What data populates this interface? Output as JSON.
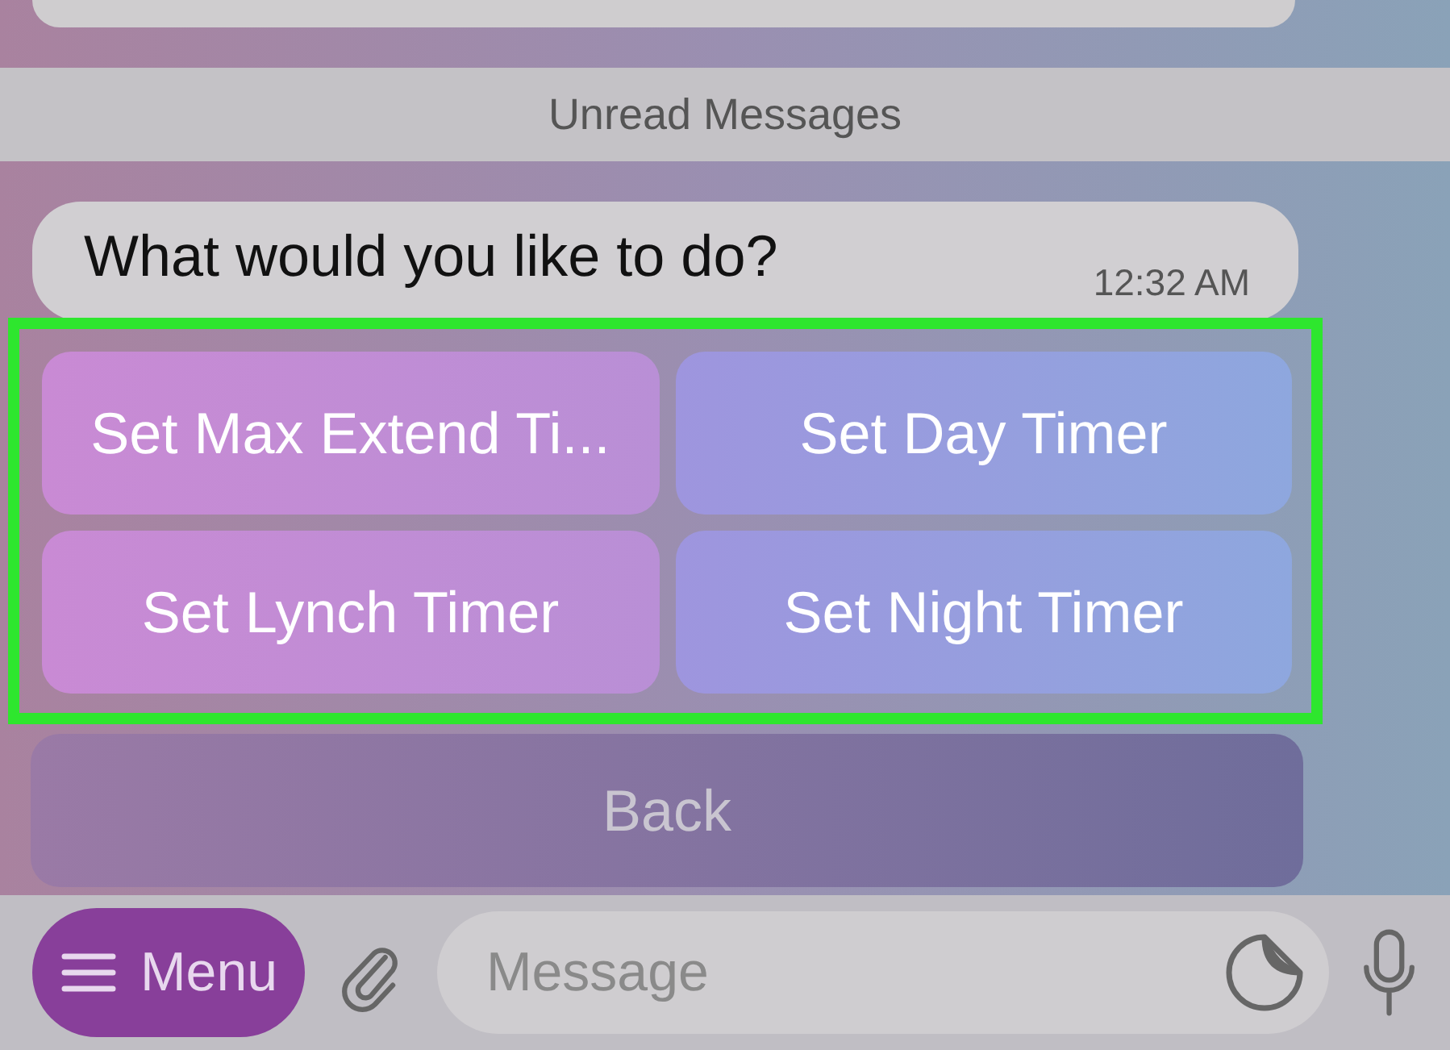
{
  "divider": {
    "label": "Unread Messages"
  },
  "message": {
    "text": "What would you like to do?",
    "time": "12:32 AM"
  },
  "keyboard": {
    "highlighted": true,
    "rows": [
      {
        "buttons": [
          "Set Max Extend Ti...",
          "Set Day Timer"
        ]
      },
      {
        "buttons": [
          "Set Lynch Timer",
          "Set Night Timer"
        ]
      }
    ],
    "back": "Back"
  },
  "input_bar": {
    "menu_label": "Menu",
    "placeholder": "Message"
  }
}
